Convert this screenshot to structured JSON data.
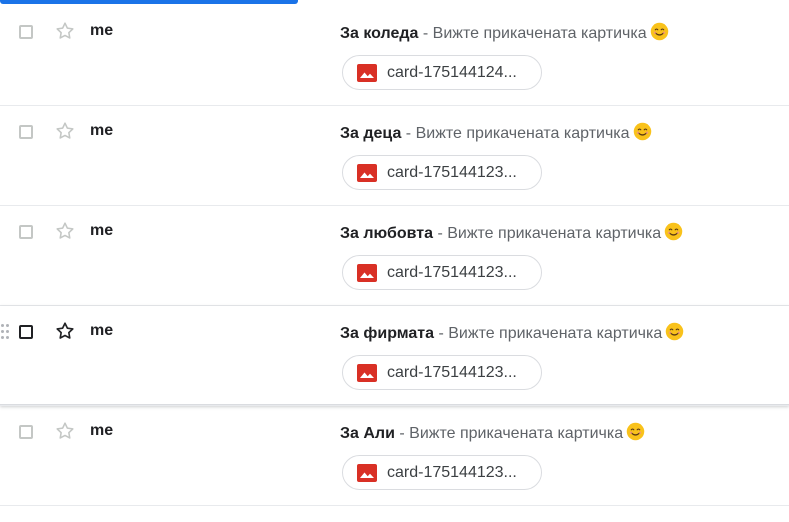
{
  "colors": {
    "accent": "#1a73e8",
    "attachment_icon": "#d93025",
    "text_primary": "#202124",
    "text_secondary": "#5f6368",
    "emoji_face": "#f9c21b"
  },
  "icons": {
    "checkbox": "checkbox-icon",
    "star": "star-icon",
    "attachment": "image-attachment-icon",
    "emoji": "smiling-face-emoji",
    "drag": "drag-handle-icon"
  },
  "emails": [
    {
      "sender": "me",
      "subject": "За коледа",
      "snippet": " - Вижте прикачената картичка",
      "attachment_name": "card-175144124...",
      "hovered": false
    },
    {
      "sender": "me",
      "subject": "За деца",
      "snippet": " - Вижте прикачената картичка",
      "attachment_name": "card-175144123...",
      "hovered": false
    },
    {
      "sender": "me",
      "subject": "За любовта",
      "snippet": " - Вижте прикачената картичка",
      "attachment_name": "card-175144123...",
      "hovered": false
    },
    {
      "sender": "me",
      "subject": "За фирмата",
      "snippet": " - Вижте прикачената картичка",
      "attachment_name": "card-175144123...",
      "hovered": true
    },
    {
      "sender": "me",
      "subject": "За Али",
      "snippet": " - Вижте прикачената картичка",
      "attachment_name": "card-175144123...",
      "hovered": false
    }
  ]
}
